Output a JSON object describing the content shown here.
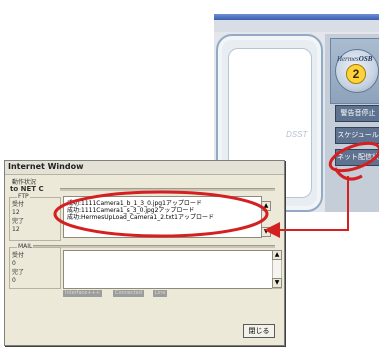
{
  "background_app": {
    "logo_text": "Hermes",
    "logo_suffix": "OSB",
    "logo_number": "2",
    "panel_mark": "DSST",
    "buttons": [
      "警告音停止",
      "スケジュール",
      "ネット配信状"
    ]
  },
  "dialog": {
    "title": "Internet Window",
    "status_heading": "動作状況",
    "to_net": "to NET C",
    "ftp": {
      "label": "FTP",
      "received_label": "受付",
      "received_value": "12",
      "completed_label": "完了",
      "completed_value": "12",
      "log_lines": [
        "成功:1111Camera1_b_1_3_0.jpg1アップロード",
        "成功:1111Camera1_s_3_0.jpg2アップロード",
        "成功:HermesUpLoad_Camera1_2.txt1アップロード"
      ]
    },
    "mail": {
      "label": "MAIL",
      "received_label": "受付",
      "received_value": "0",
      "completed_label": "完了",
      "completed_value": "0"
    },
    "status_chips": [
      "Interface+++",
      "Connected",
      "Line"
    ],
    "close_label": "閉じる"
  },
  "colors": {
    "annotation": "#d42020",
    "dialog_bg": "#ece9d8",
    "sidebar_button": "#5f7390"
  }
}
